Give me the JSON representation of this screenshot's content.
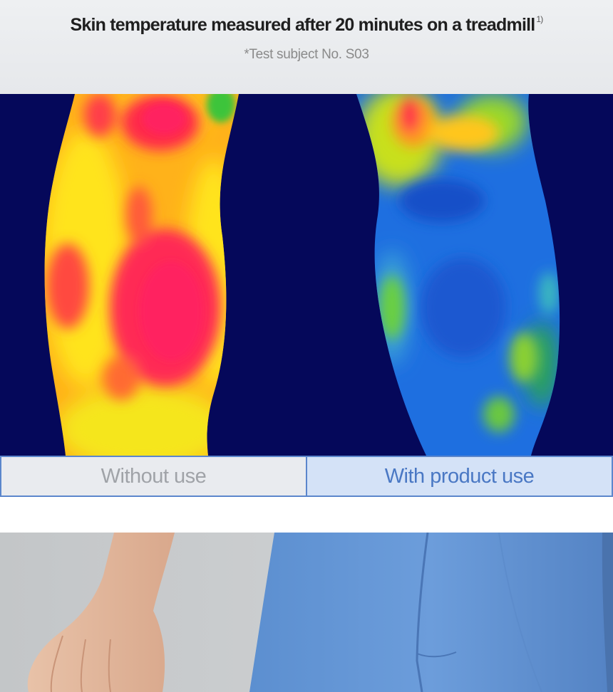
{
  "header": {
    "title": "Skin temperature measured after 20 minutes on a treadmill",
    "footnote_marker": "1)",
    "subtitle": "*Test subject No. S03"
  },
  "comparison": {
    "left_label": "Without use",
    "right_label": "With product use"
  },
  "colors": {
    "thermal_background": "#05085a",
    "hot": "#ff2a4a",
    "warm": "#ffd21a",
    "cool": "#1e6fe0",
    "tab_border": "#5b86cc",
    "tab_active_text": "#4a78c4",
    "tab_inactive_text": "#a0a3a8"
  },
  "icons": {
    "thermal_image": "thermal-comparison-image",
    "model_photo": "model-wearing-blue-pants-photo"
  }
}
